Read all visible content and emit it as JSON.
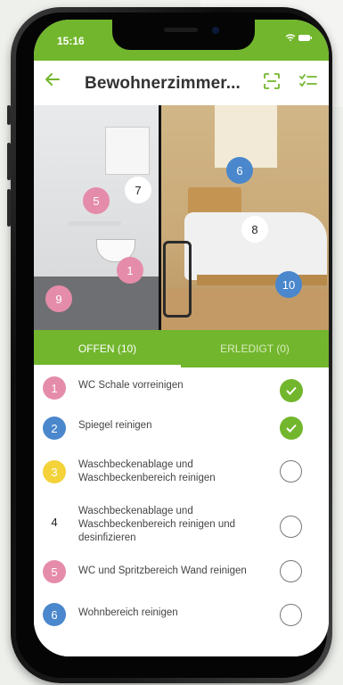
{
  "status": {
    "time": "15:16"
  },
  "header": {
    "title": "Bewohnerzimmer..."
  },
  "photo_markers": [
    {
      "n": "5",
      "color": "pink"
    },
    {
      "n": "7",
      "color": "white"
    },
    {
      "n": "1",
      "color": "pink"
    },
    {
      "n": "9",
      "color": "pink"
    },
    {
      "n": "6",
      "color": "blue"
    },
    {
      "n": "8",
      "color": "white"
    },
    {
      "n": "10",
      "color": "blue"
    }
  ],
  "tabs": [
    {
      "label": "OFFEN (10)",
      "active": true
    },
    {
      "label": "ERLEDIGT (0)",
      "active": false
    }
  ],
  "tasks": [
    {
      "n": "1",
      "color": "pink",
      "text": "WC Schale vorreinigen",
      "done": true
    },
    {
      "n": "2",
      "color": "blue",
      "text": "Spiegel reinigen",
      "done": true
    },
    {
      "n": "3",
      "color": "yellow",
      "text": "Waschbeckenablage und Waschbeckenbereich reinigen",
      "done": false
    },
    {
      "n": "4",
      "color": "white",
      "text": "Waschbeckenablage und Waschbeckenbereich reinigen und desinfizieren",
      "done": false
    },
    {
      "n": "5",
      "color": "pink",
      "text": "WC und Spritzbereich Wand reinigen",
      "done": false
    },
    {
      "n": "6",
      "color": "blue",
      "text": "Wohnbereich reinigen",
      "done": false
    }
  ],
  "colors": {
    "accent": "#72b62d",
    "pink": "#e58caa",
    "blue": "#4a87cc",
    "yellow": "#f3d23a"
  },
  "icons": {
    "back": "arrow-left-icon",
    "scan": "scan-icon",
    "checklist": "checklist-icon",
    "check": "checkmark-icon"
  }
}
